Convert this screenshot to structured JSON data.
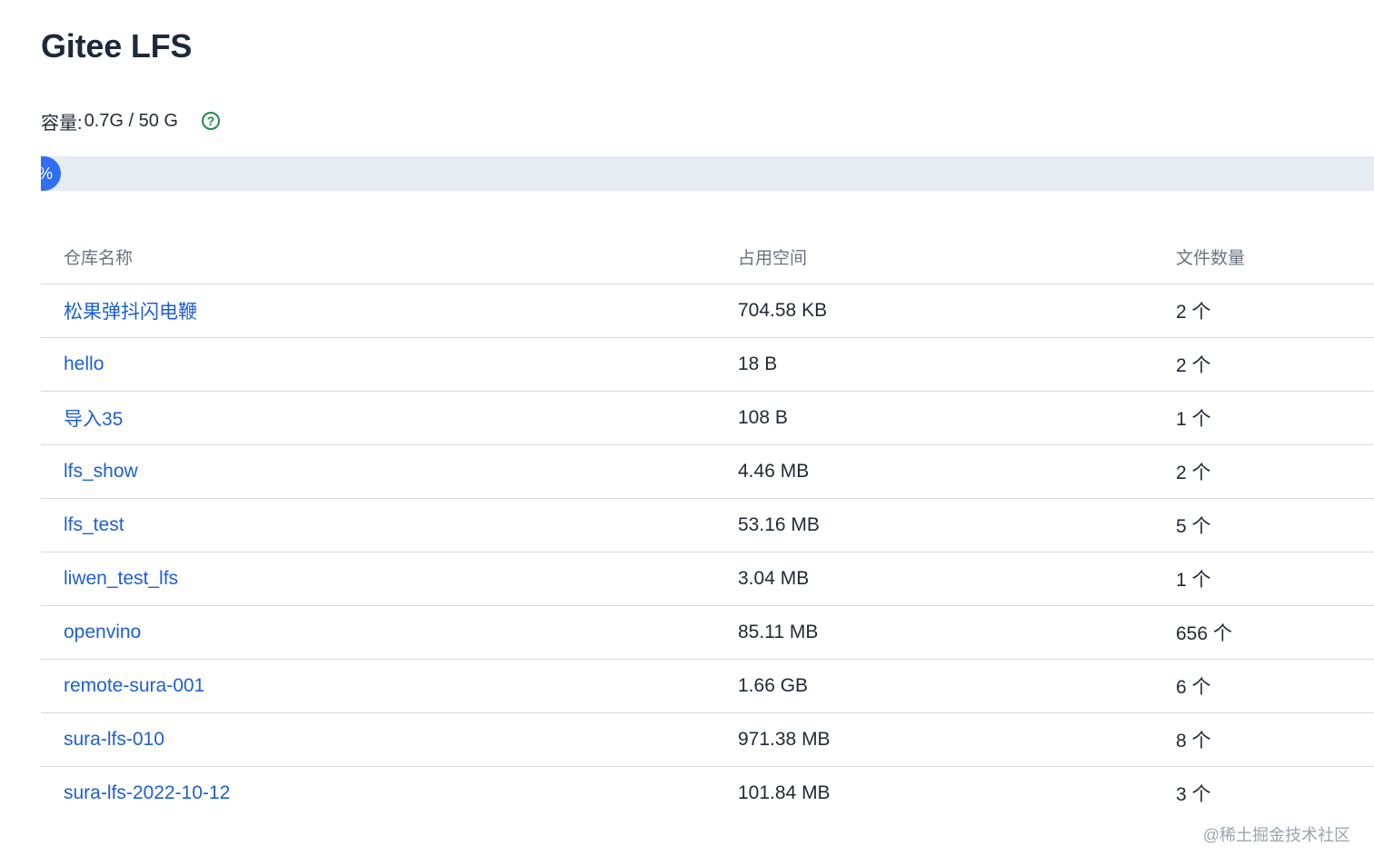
{
  "page": {
    "title": "Gitee LFS"
  },
  "capacity": {
    "label": "容量:",
    "value": "0.7G / 50 G",
    "help_icon": "question-circle-icon",
    "used_fraction": 0.014,
    "progress_text": "%"
  },
  "table": {
    "headers": {
      "name": "仓库名称",
      "size": "占用空间",
      "count": "文件数量"
    },
    "rows": [
      {
        "name": "松果弹抖闪电鞭",
        "size": "704.58 KB",
        "count": "2 个"
      },
      {
        "name": "hello",
        "size": "18 B",
        "count": "2 个"
      },
      {
        "name": "导入35",
        "size": "108 B",
        "count": "1 个"
      },
      {
        "name": "lfs_show",
        "size": "4.46 MB",
        "count": "2 个"
      },
      {
        "name": "lfs_test",
        "size": "53.16 MB",
        "count": "5 个"
      },
      {
        "name": "liwen_test_lfs",
        "size": "3.04 MB",
        "count": "1 个"
      },
      {
        "name": "openvino",
        "size": "85.11 MB",
        "count": "656 个"
      },
      {
        "name": "remote-sura-001",
        "size": "1.66 GB",
        "count": "6 个"
      },
      {
        "name": "sura-lfs-010",
        "size": "971.38 MB",
        "count": "8 个"
      },
      {
        "name": "sura-lfs-2022-10-12",
        "size": "101.84 MB",
        "count": "3 个"
      }
    ]
  },
  "watermark": "@稀土掘金技术社区",
  "colors": {
    "link": "#1d5fd6",
    "progress": "#2f6ef5",
    "track": "#e7ebf2",
    "help": "#1f8a4c"
  }
}
